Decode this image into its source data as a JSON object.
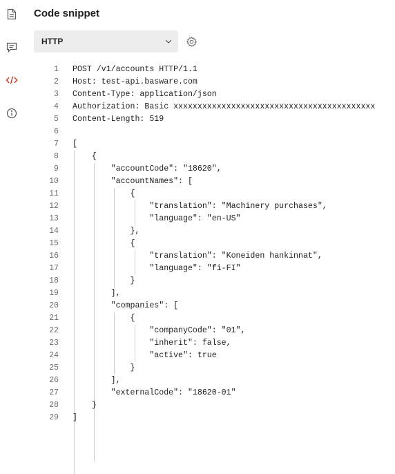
{
  "header": {
    "title": "Code snippet"
  },
  "toolbar": {
    "language_value": "HTTP"
  },
  "rail": {
    "icons": [
      "document-icon",
      "comment-icon",
      "code-icon",
      "info-icon"
    ],
    "active_color": "#e0301e"
  },
  "code": {
    "lines": [
      "POST /v1/accounts HTTP/1.1",
      "Host: test-api.basware.com",
      "Content-Type: application/json",
      "Authorization: Basic xxxxxxxxxxxxxxxxxxxxxxxxxxxxxxxxxxxxxxxxxx",
      "Content-Length: 519",
      "",
      "[",
      "    {",
      "        \"accountCode\": \"18620\",",
      "        \"accountNames\": [",
      "            {",
      "                \"translation\": \"Machinery purchases\",",
      "                \"language\": \"en-US\"",
      "            },",
      "            {",
      "                \"translation\": \"Koneiden hankinnat\",",
      "                \"language\": \"fi-FI\"",
      "            }",
      "        ],",
      "        \"companies\": [",
      "            {",
      "                \"companyCode\": \"01\",",
      "                \"inherit\": false,",
      "                \"active\": true",
      "            }",
      "        ],",
      "        \"externalCode\": \"18620-01\"",
      "    }",
      "]"
    ]
  }
}
